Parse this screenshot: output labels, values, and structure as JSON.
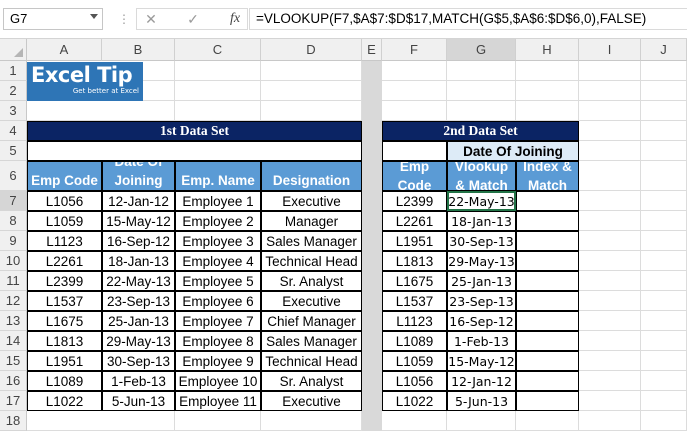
{
  "formula_bar": {
    "name_box": "G7",
    "cancel_symbol": "✕",
    "enter_symbol": "✓",
    "fx_label": "fx",
    "formula": "=VLOOKUP(F7,$A$7:$D$17,MATCH(G$5,$A$6:$D$6,0),FALSE)"
  },
  "columns": [
    "A",
    "B",
    "C",
    "D",
    "E",
    "F",
    "G",
    "H",
    "I",
    "J"
  ],
  "rows": [
    "1",
    "2",
    "3",
    "4",
    "5",
    "6",
    "7",
    "8",
    "9",
    "10",
    "11",
    "12",
    "13",
    "14",
    "15",
    "16",
    "17",
    "18"
  ],
  "logo": {
    "title": "Excel Tip",
    "tagline": "Get better at Excel"
  },
  "table1": {
    "title": "1st Data Set",
    "headers": [
      "Emp Code",
      "Date Of\nJoining",
      "Emp. Name",
      "Designation"
    ],
    "rows": [
      [
        "L1056",
        "12-Jan-12",
        "Employee 1",
        "Executive"
      ],
      [
        "L1059",
        "15-May-12",
        "Employee 2",
        "Manager"
      ],
      [
        "L1123",
        "16-Sep-12",
        "Employee 3",
        "Sales Manager"
      ],
      [
        "L2261",
        "18-Jan-13",
        "Employee 4",
        "Technical Head"
      ],
      [
        "L2399",
        "22-May-13",
        "Employee 5",
        "Sr. Analyst"
      ],
      [
        "L1537",
        "23-Sep-13",
        "Employee 6",
        "Executive"
      ],
      [
        "L1675",
        "25-Jan-13",
        "Employee 7",
        "Chief Manager"
      ],
      [
        "L1813",
        "29-May-13",
        "Employee 8",
        "Sales Manager"
      ],
      [
        "L1951",
        "30-Sep-13",
        "Employee 9",
        "Technical Head"
      ],
      [
        "L1089",
        "1-Feb-13",
        "Employee 10",
        "Sr. Analyst"
      ],
      [
        "L1022",
        "5-Jun-13",
        "Employee 11",
        "Executive"
      ]
    ]
  },
  "table2": {
    "title": "2nd Data Set",
    "lookup_header": "Date Of Joining",
    "headers": [
      "Emp\nCode",
      "Vlookup\n& Match",
      "Index &\nMatch"
    ],
    "rows": [
      [
        "L2399",
        "22-May-13",
        ""
      ],
      [
        "L2261",
        "18-Jan-13",
        ""
      ],
      [
        "L1951",
        "30-Sep-13",
        ""
      ],
      [
        "L1813",
        "29-May-13",
        ""
      ],
      [
        "L1675",
        "25-Jan-13",
        ""
      ],
      [
        "L1537",
        "23-Sep-13",
        ""
      ],
      [
        "L1123",
        "16-Sep-12",
        ""
      ],
      [
        "L1089",
        "1-Feb-13",
        ""
      ],
      [
        "L1059",
        "15-May-12",
        ""
      ],
      [
        "L1056",
        "12-Jan-12",
        ""
      ],
      [
        "L1022",
        "5-Jun-13",
        ""
      ]
    ]
  }
}
